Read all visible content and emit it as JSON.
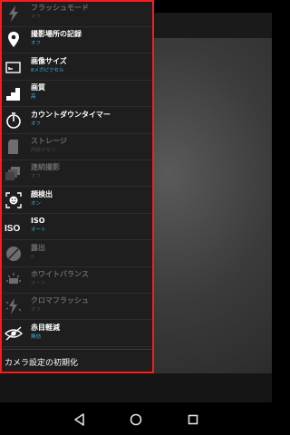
{
  "settings": [
    {
      "name": "flash-mode",
      "label": "フラッシュモード",
      "value": "オフ",
      "icon": "flash-icon",
      "enabled": false
    },
    {
      "name": "location-record",
      "label": "撮影場所の記録",
      "value": "オフ",
      "icon": "location-pin-icon",
      "enabled": true
    },
    {
      "name": "image-size",
      "label": "画像サイズ",
      "value": "8メガピクセル",
      "icon": "image-size-icon",
      "enabled": true
    },
    {
      "name": "image-quality",
      "label": "画質",
      "value": "高",
      "icon": "quality-bars-icon",
      "enabled": true
    },
    {
      "name": "countdown-timer",
      "label": "カウントダウンタイマー",
      "value": "オフ",
      "icon": "timer-icon",
      "enabled": true
    },
    {
      "name": "storage",
      "label": "ストレージ",
      "value": "内部メモリ",
      "icon": "sd-card-icon",
      "enabled": false
    },
    {
      "name": "burst-shot",
      "label": "連続撮影",
      "value": "オフ",
      "icon": "burst-icon",
      "enabled": false
    },
    {
      "name": "face-detection",
      "label": "顔検出",
      "value": "オン",
      "icon": "face-detect-icon",
      "enabled": true
    },
    {
      "name": "iso",
      "label": "ISO",
      "value": "オート",
      "icon": "iso-icon",
      "enabled": true
    },
    {
      "name": "exposure",
      "label": "露出",
      "value": "0",
      "icon": "exposure-icon",
      "enabled": false
    },
    {
      "name": "white-balance",
      "label": "ホワイトバランス",
      "value": "オート",
      "icon": "white-balance-icon",
      "enabled": false
    },
    {
      "name": "chroma-flash",
      "label": "クロマフラッシュ",
      "value": "オフ",
      "icon": "chroma-flash-icon",
      "enabled": false
    },
    {
      "name": "red-eye-reduction",
      "label": "赤目軽減",
      "value": "無効",
      "icon": "red-eye-icon",
      "enabled": true
    }
  ],
  "reset_label": "カメラ設定の初期化",
  "colors": {
    "highlight_border": "#ff1a1a",
    "value_accent": "#33b5e5"
  },
  "nav": {
    "back_icon": "back-triangle-icon",
    "home_icon": "home-circle-icon",
    "recents_icon": "recents-square-icon"
  }
}
